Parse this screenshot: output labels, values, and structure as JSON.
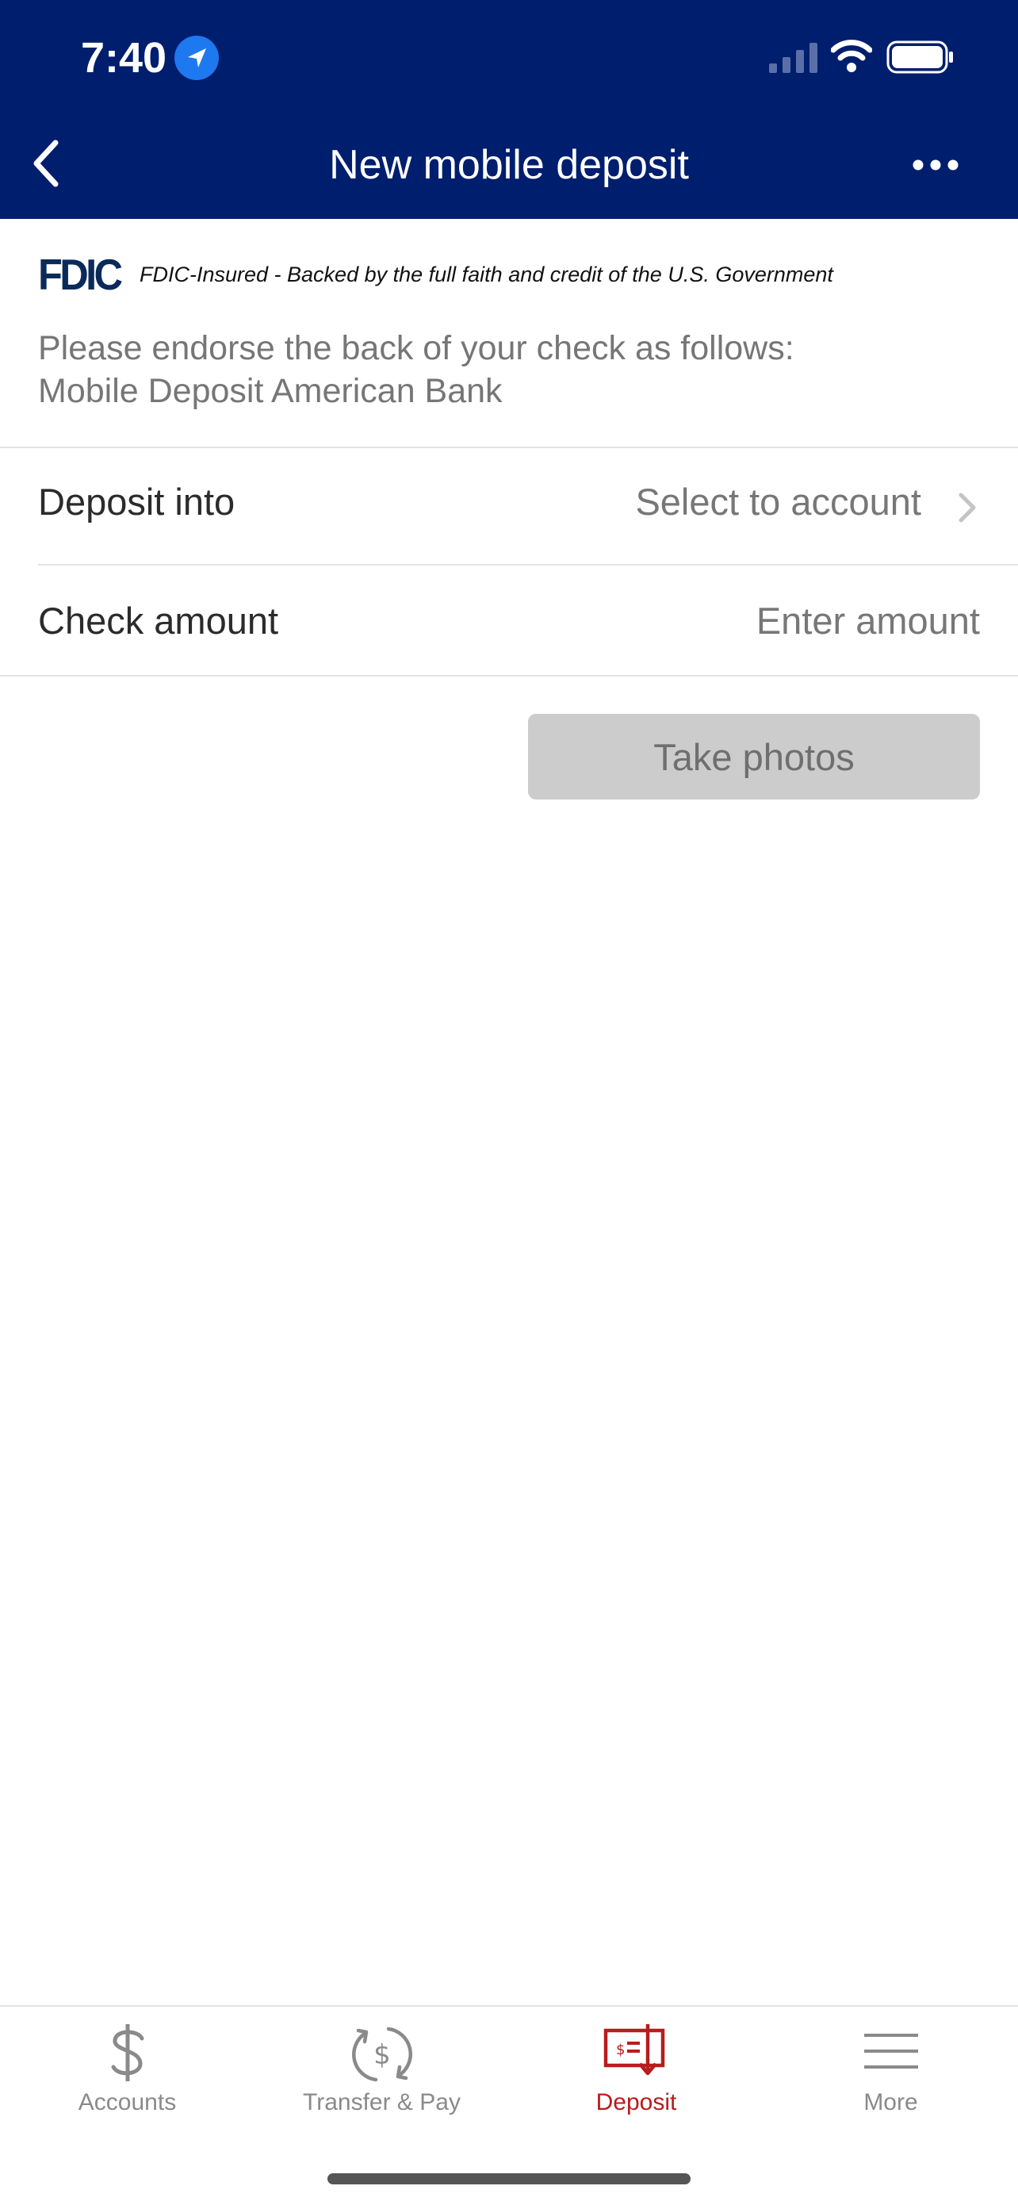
{
  "status_bar": {
    "time": "7:40"
  },
  "header": {
    "title": "New mobile deposit"
  },
  "fdic": {
    "logo": "FDIC",
    "disclaimer": "FDIC-Insured - Backed by the full faith and credit of the U.S. Government"
  },
  "endorse": {
    "line1": "Please endorse the back of your check as follows:",
    "line2": "Mobile Deposit American Bank"
  },
  "deposit_into": {
    "label": "Deposit into",
    "value": "Select to account"
  },
  "check_amount": {
    "label": "Check amount",
    "placeholder": "Enter amount"
  },
  "take_photos": {
    "label": "Take photos"
  },
  "tabs": [
    {
      "label": "Accounts",
      "icon": "dollar-icon"
    },
    {
      "label": "Transfer & Pay",
      "icon": "transfer-pay-icon"
    },
    {
      "label": "Deposit",
      "icon": "deposit-check-icon"
    },
    {
      "label": "More",
      "icon": "menu-icon"
    }
  ],
  "colors": {
    "header_bg": "#001e6e",
    "active_tab": "#b81c1c",
    "disabled_button": "#cccccc"
  }
}
